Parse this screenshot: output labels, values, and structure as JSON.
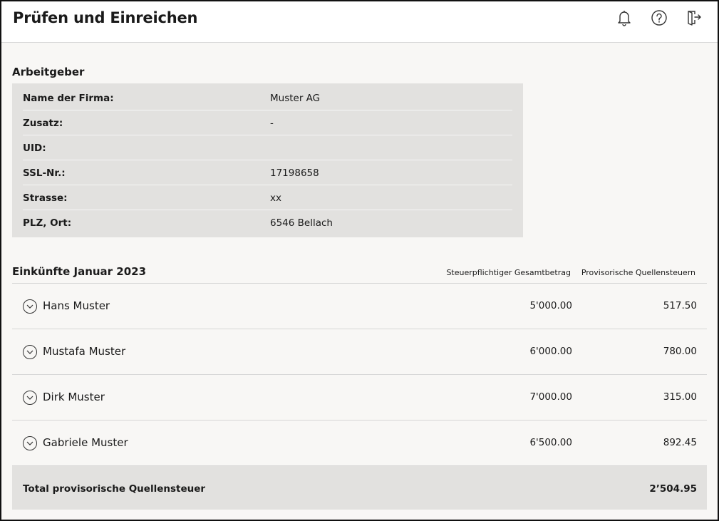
{
  "header": {
    "title": "Prüfen und Einreichen",
    "icons": [
      "bell-icon",
      "help-icon",
      "logout-icon"
    ]
  },
  "employer": {
    "title": "Arbeitgeber",
    "rows": [
      {
        "label": "Name der Firma:",
        "value": "Muster AG"
      },
      {
        "label": "Zusatz:",
        "value": "-"
      },
      {
        "label": "UID:",
        "value": ""
      },
      {
        "label": "SSL-Nr.:",
        "value": "17198658"
      },
      {
        "label": "Strasse:",
        "value": "xx"
      },
      {
        "label": "PLZ, Ort:",
        "value": "6546 Bellach"
      }
    ]
  },
  "income": {
    "title": "Einkünfte Januar 2023",
    "col_taxable": "Steuerpflichtiger Gesamtbetrag",
    "col_tax": "Provisorische Quellensteuern",
    "rows": [
      {
        "name": "Hans Muster",
        "taxable": "5'000.00",
        "tax": "517.50"
      },
      {
        "name": "Mustafa Muster",
        "taxable": "6'000.00",
        "tax": "780.00"
      },
      {
        "name": "Dirk Muster",
        "taxable": "7'000.00",
        "tax": "315.00"
      },
      {
        "name": "Gabriele Muster",
        "taxable": "6'500.00",
        "tax": "892.45"
      }
    ],
    "total_label": "Total provisorische Quellensteuer",
    "total_value": "2’504.95"
  },
  "colors": {
    "panel": "#e2e1df",
    "background": "#f8f7f5",
    "header": "#ffffff"
  }
}
